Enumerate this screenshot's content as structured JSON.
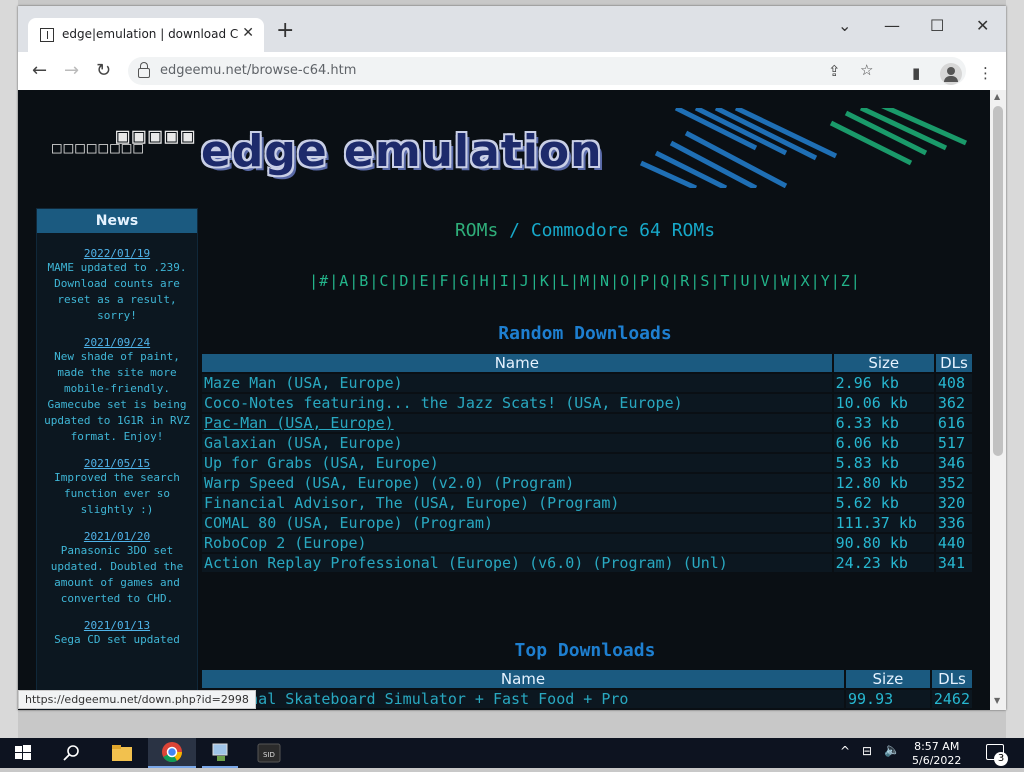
{
  "browser": {
    "tab_title": "edge|emulation | download Com",
    "url_domain": "edgeemu.net",
    "url_path": "/browse-c64.htm",
    "status_url": "https://edgeemu.net/down.php?id=2998"
  },
  "site": {
    "logo_text": "edge emulation",
    "logo_pixels": "□□□□□□□□",
    "logo_pixels2": "▣▣▣▣▣"
  },
  "sidebar": {
    "header": "News",
    "items": [
      {
        "date": "2022/01/19",
        "text": "MAME updated to .239. Download counts are reset as a result, sorry!"
      },
      {
        "date": "2021/09/24",
        "text": "New shade of paint, made the site more mobile-friendly. Gamecube set is being updated to 1G1R in RVZ format. Enjoy!"
      },
      {
        "date": "2021/05/15",
        "text": "Improved the search function ever so slightly :)"
      },
      {
        "date": "2021/01/20",
        "text": "Panasonic 3DO set updated. Doubled the amount of games and converted to CHD."
      },
      {
        "date": "2021/01/13",
        "text": "Sega CD set updated"
      }
    ]
  },
  "main": {
    "heading_roms": "ROMs",
    "heading_sep": " / ",
    "heading_platform": "Commodore 64 ROMs",
    "alphabet": "|#|A|B|C|D|E|F|G|H|I|J|K|L|M|N|O|P|Q|R|S|T|U|V|W|X|Y|Z|",
    "random_title": "Random Downloads",
    "top_title": "Top Downloads",
    "col_name": "Name",
    "col_size": "Size",
    "col_dls": "DLs",
    "random_rows": [
      {
        "name": "Maze Man (USA, Europe)",
        "size": "2.96 kb",
        "dls": "408"
      },
      {
        "name": "Coco-Notes featuring... the Jazz Scats! (USA, Europe)",
        "size": "10.06 kb",
        "dls": "362"
      },
      {
        "name": "Pac-Man (USA, Europe)",
        "size": "6.33 kb",
        "dls": "616"
      },
      {
        "name": "Galaxian (USA, Europe)",
        "size": "6.06 kb",
        "dls": "517"
      },
      {
        "name": "Up for Grabs (USA, Europe)",
        "size": "5.83 kb",
        "dls": "346"
      },
      {
        "name": "Warp Speed (USA, Europe) (v2.0) (Program)",
        "size": "12.80 kb",
        "dls": "352"
      },
      {
        "name": "Financial Advisor, The (USA, Europe) (Program)",
        "size": "5.62 kb",
        "dls": "320"
      },
      {
        "name": "COMAL 80 (USA, Europe) (Program)",
        "size": "111.37 kb",
        "dls": "336"
      },
      {
        "name": "RoboCop 2 (Europe)",
        "size": "90.80 kb",
        "dls": "440"
      },
      {
        "name": "Action Replay Professional (Europe) (v6.0) (Program) (Unl)",
        "size": "24.23 kb",
        "dls": "341"
      }
    ],
    "top_rows": [
      {
        "name": "essional Skateboard Simulator + Fast Food + Pro",
        "size": "99.93",
        "dls": "2462"
      }
    ]
  },
  "taskbar": {
    "time": "8:57 AM",
    "date": "5/6/2022",
    "notifications": "3"
  }
}
